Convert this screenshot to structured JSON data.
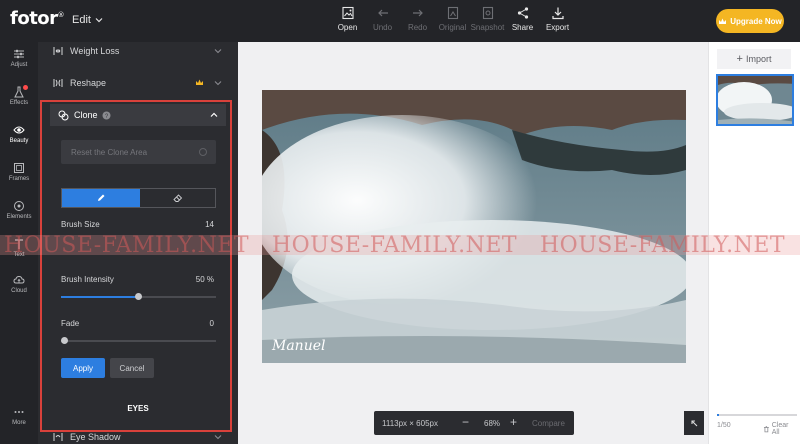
{
  "app": {
    "logo": "fotor",
    "logo_mark": "®",
    "edit_menu": "Edit",
    "upgrade_label": "Upgrade Now",
    "accent": "#2d7ee0",
    "upgrade_color": "#f4b623",
    "highlight_border": "#d9413b"
  },
  "toolbar": [
    {
      "label": "Open",
      "icon": "open-image-icon",
      "enabled": true
    },
    {
      "label": "Undo",
      "icon": "undo-arrow-icon",
      "enabled": false
    },
    {
      "label": "Redo",
      "icon": "redo-arrow-icon",
      "enabled": false
    },
    {
      "label": "Original",
      "icon": "original-icon",
      "enabled": false
    },
    {
      "label": "Snapshot",
      "icon": "snapshot-icon",
      "enabled": false
    },
    {
      "label": "Share",
      "icon": "share-icon",
      "enabled": true
    },
    {
      "label": "Export",
      "icon": "export-icon",
      "enabled": true
    }
  ],
  "rail": [
    {
      "label": "Adjust",
      "icon": "sliders-icon"
    },
    {
      "label": "Effects",
      "icon": "flask-icon",
      "badge": true
    },
    {
      "label": "Beauty",
      "icon": "eye-icon",
      "active": true
    },
    {
      "label": "Frames",
      "icon": "frame-icon"
    },
    {
      "label": "Elements",
      "icon": "shapes-icon"
    },
    {
      "label": "Text",
      "icon": "text-icon"
    },
    {
      "label": "Cloud",
      "icon": "cloud-icon"
    },
    {
      "label": "More",
      "icon": "more-dots-icon"
    }
  ],
  "panel": {
    "weight_loss": "Weight Loss",
    "reshape": "Reshape",
    "clone": {
      "title": "Clone",
      "reset_label": "Reset the Clone Area",
      "brush_size_label": "Brush Size",
      "brush_size_value": "14",
      "brush_intensity_label": "Brush Intensity",
      "brush_intensity_value": "50 %",
      "brush_intensity_fraction": 0.5,
      "fade_label": "Fade",
      "fade_value": "0",
      "fade_fraction": 0,
      "apply_label": "Apply",
      "cancel_label": "Cancel"
    },
    "section_eyes": "EYES",
    "eye_shadow": "Eye Shadow"
  },
  "canvas": {
    "dimensions": "1113px × 605px",
    "zoom": "68%",
    "minus": "−",
    "plus": "+",
    "compare_label": "Compare",
    "signature": "Manuel"
  },
  "right_panel": {
    "import_label": "Import",
    "count": "1/50",
    "clear_label": "Clear All"
  },
  "watermark": {
    "text": "HOUSE-FAMILY.NET"
  }
}
